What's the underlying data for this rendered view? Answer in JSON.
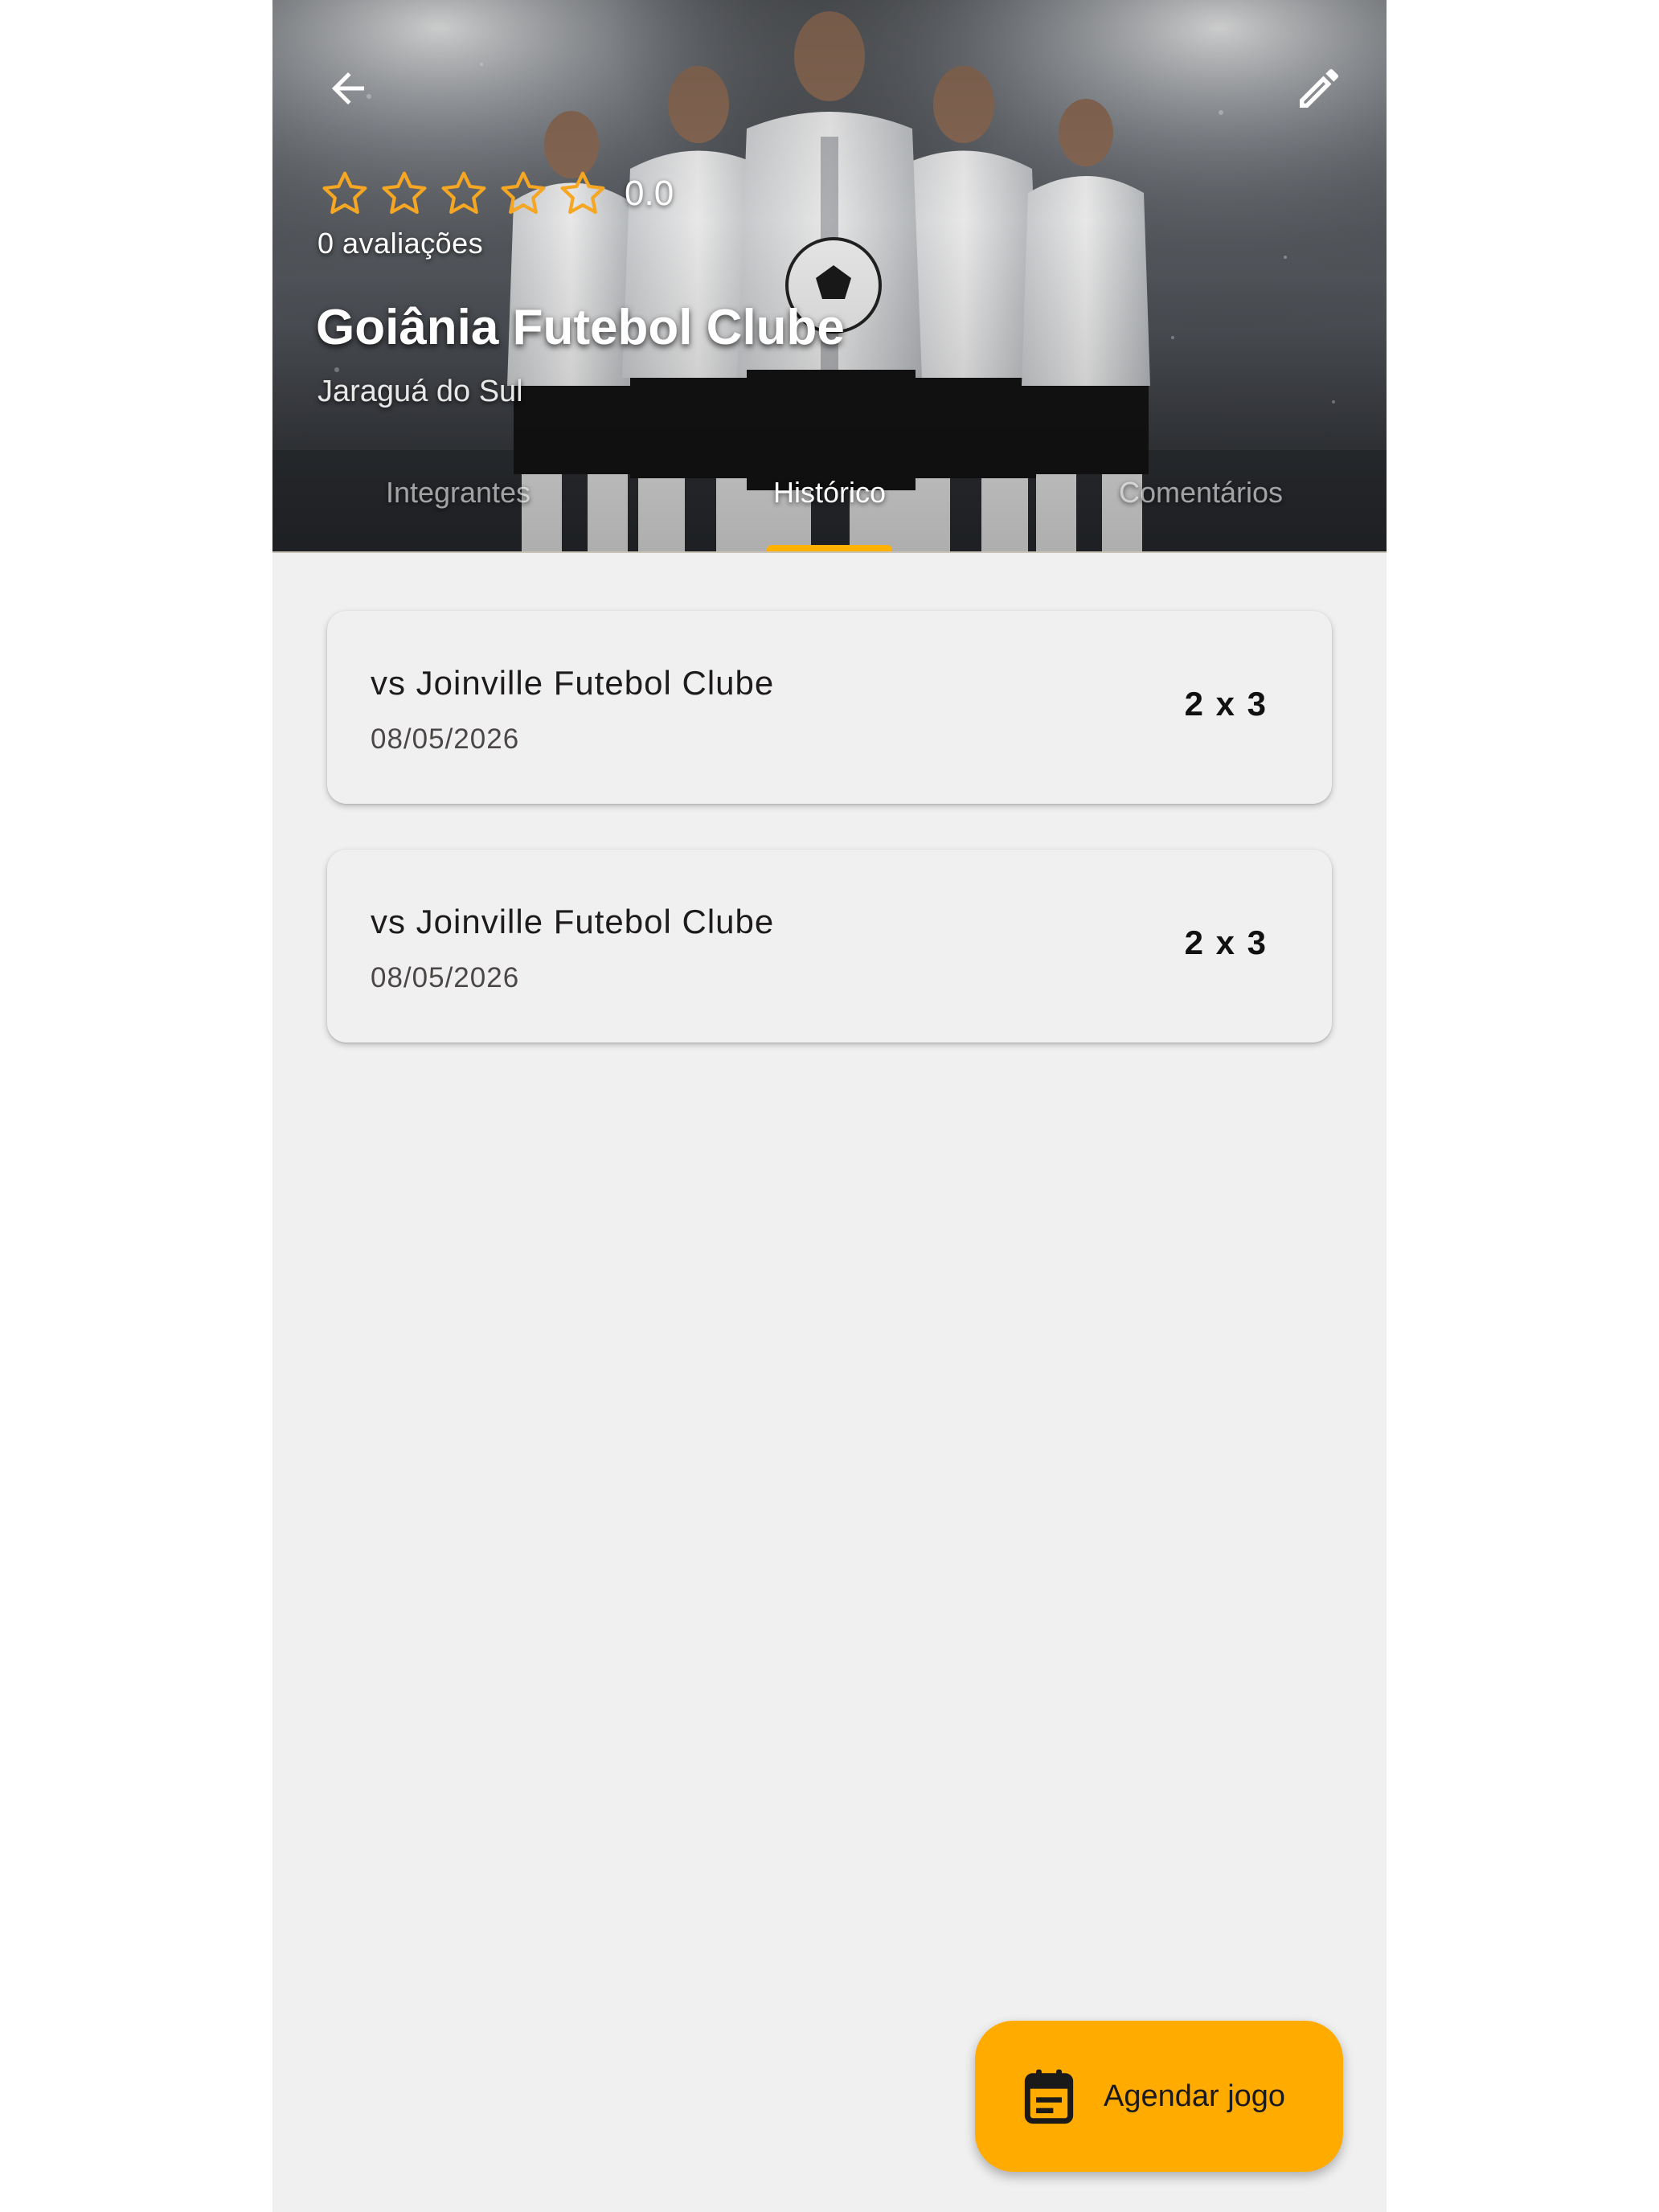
{
  "header": {
    "rating_value": "0.0",
    "rating_stars": 0,
    "reviews_label": "0 avaliações",
    "team_name": "Goiânia Futebol Clube",
    "city": "Jaraguá do Sul"
  },
  "tabs": [
    {
      "label": "Integrantes",
      "active": false
    },
    {
      "label": "Histórico",
      "active": true
    },
    {
      "label": "Comentários",
      "active": false
    }
  ],
  "matches": [
    {
      "opponent": "vs Joinville Futebol Clube",
      "date": "08/05/2026",
      "score": "2 x 3"
    },
    {
      "opponent": "vs Joinville Futebol Clube",
      "date": "08/05/2026",
      "score": "2 x 3"
    }
  ],
  "fab": {
    "label": "Agendar jogo",
    "icon": "calendar-event-icon"
  },
  "colors": {
    "accent": "#ffab00",
    "tab_indicator": "#ffb000",
    "background": "#f0f0f0",
    "card": "#f1f0f0",
    "star_outline": "#f5a623"
  },
  "icons": {
    "back": "arrow-left-icon",
    "edit": "pencil-icon",
    "star": "star-outline-icon"
  }
}
